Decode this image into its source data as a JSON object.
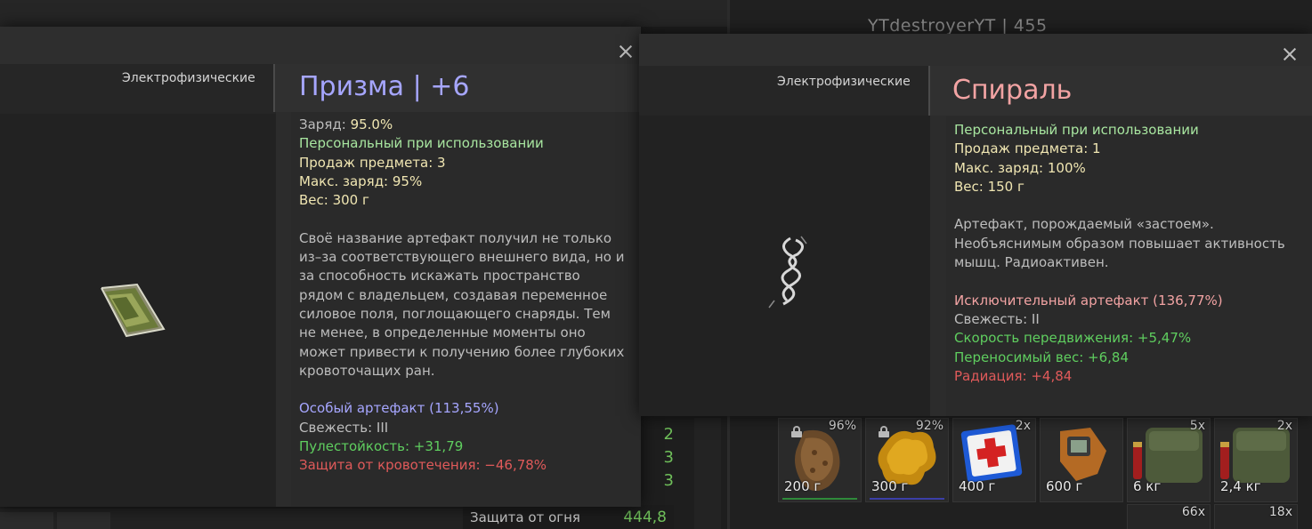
{
  "background": {
    "username": "YTdestroyerYT | 455",
    "stat_numbers": [
      "2",
      "3",
      "3"
    ],
    "fire_protection": {
      "label": "Защита от огня",
      "value": "444,8"
    }
  },
  "inventory": [
    {
      "weight": "200 г",
      "count": "96%",
      "locked": true,
      "item_icon": "brown-artifact-icon",
      "bar_color": "#2f8a3a"
    },
    {
      "weight": "300 г",
      "count": "92%",
      "locked": true,
      "item_icon": "yellow-artifact-icon",
      "bar_color": "#3b3fa8"
    },
    {
      "weight": "400 г",
      "count": "2x",
      "locked": false,
      "item_icon": "medkit-icon",
      "bar_color": ""
    },
    {
      "weight": "600 г",
      "count": "",
      "locked": false,
      "item_icon": "detector-icon",
      "bar_color": ""
    },
    {
      "weight": "6 кг",
      "count": "5x",
      "locked": false,
      "item_icon": "ammo-pouch-icon",
      "bar_color": ""
    },
    {
      "weight": "2,4 кг",
      "count": "2x",
      "locked": false,
      "item_icon": "ammo-pouch-icon",
      "bar_color": ""
    }
  ],
  "inventory_row2": [
    {
      "count": "66x"
    },
    {
      "count": "18x"
    }
  ],
  "popup_prism": {
    "category": "Электрофизические",
    "title": "Призма | +6",
    "title_color": "#a6a6ff",
    "charge_label": "Заряд:",
    "charge_value": "95.0%",
    "personal": "Персональный при использовании",
    "sales": "Продаж предмета: 3",
    "max_charge": "Макс. заряд: 95%",
    "weight": "Вес: 300 г",
    "description": [
      "Своё название артефакт получил не только",
      "из–за соответствующего внешнего вида, но и",
      "за способность искажать пространство",
      "рядом с владельцем, создавая переменное",
      "силовое поля, поглощающего снаряды. Тем",
      "не менее, в определенные моменты оно",
      "может привести к получению более глубоких",
      "кровоточащих ран."
    ],
    "rarity": "Особый артефакт (113,55%)",
    "freshness": "Свежесть: III",
    "bullet_res": "Пулестойкость: +31,79",
    "bleed_prot": "Защита от кровотечения: −46,78%"
  },
  "popup_spiral": {
    "category": "Электрофизические",
    "title": "Спираль",
    "title_color": "#f2a3a3",
    "personal": "Персональный при использовании",
    "sales": "Продаж предмета: 1",
    "max_charge": "Макс. заряд: 100%",
    "weight": "Вес: 150 г",
    "description": [
      "Артефакт, порождаемый «застоем».",
      "Необъяснимым образом повышает активность",
      "мышц. Радиоактивен."
    ],
    "rarity": "Исключительный артефакт (136,77%)",
    "freshness": "Свежесть: II",
    "move_speed": "Скорость передвижения: +5,47%",
    "carry_weight": "Переносимый вес: +6,84",
    "radiation": "Радиация: +4,84"
  }
}
